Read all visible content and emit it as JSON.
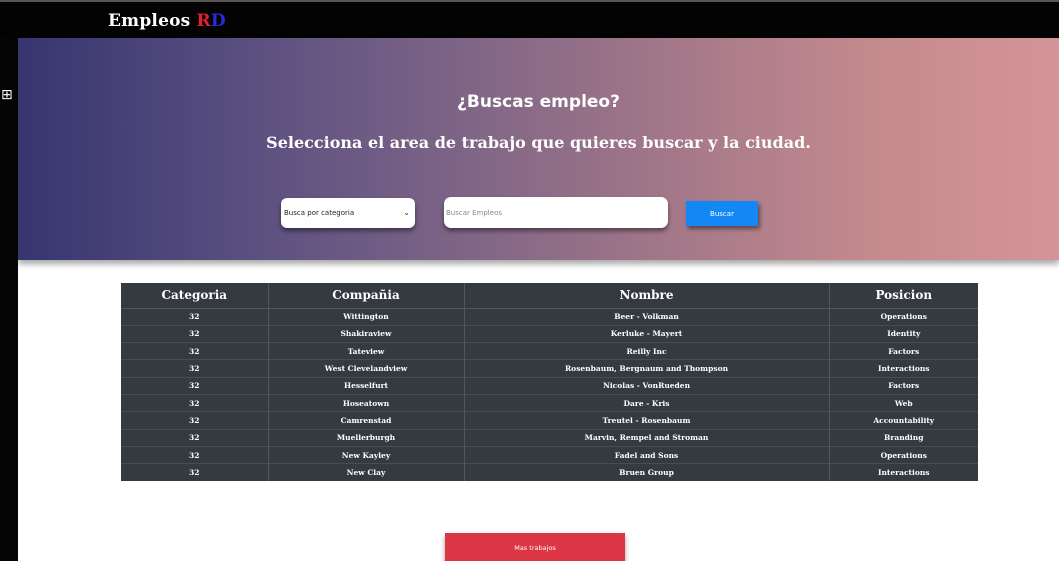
{
  "navbar": {
    "brand_main": "Empleos ",
    "brand_r": "R",
    "brand_d": "D"
  },
  "sidebar": {
    "toggle_icon": "grid-icon",
    "toggle_glyph": "⊞"
  },
  "hero": {
    "question": "¿Buscas empleo?",
    "subtitle": "Selecciona el area de trabajo que quieres buscar y la ciudad.",
    "category_select_value": "Busca por categoria",
    "search_placeholder": "Buscar Empleos",
    "search_button": "Buscar"
  },
  "table": {
    "headers": [
      "Categoria",
      "Compañia",
      "Nombre",
      "Posicion"
    ],
    "rows": [
      [
        "32",
        "Wittington",
        "Beer - Volkman",
        "Operations"
      ],
      [
        "32",
        "Shakiraview",
        "Kerluke - Mayert",
        "Identity"
      ],
      [
        "32",
        "Tateview",
        "Reilly Inc",
        "Factors"
      ],
      [
        "32",
        "West Clevelandview",
        "Rosenbaum, Bergnaum and Thompson",
        "Interactions"
      ],
      [
        "32",
        "Hesselfurt",
        "Nicolas - VonRueden",
        "Factors"
      ],
      [
        "32",
        "Hoseatown",
        "Dare - Kris",
        "Web"
      ],
      [
        "32",
        "Camrenstad",
        "Treutel - Rosenbaum",
        "Accountability"
      ],
      [
        "32",
        "Muellerburgh",
        "Marvin, Rempel and Stroman",
        "Branding"
      ],
      [
        "32",
        "New Kayley",
        "Fadel and Sons",
        "Operations"
      ],
      [
        "32",
        "New Clay",
        "Bruen Group",
        "Interactions"
      ]
    ]
  },
  "more_button": "Mas trabajos",
  "colors": {
    "navbar": "#030303",
    "table_bg": "#343a40",
    "buscar": "#1388f5",
    "mas": "#dc3545",
    "brand_r": "#e2202c",
    "brand_d": "#2b2bd8"
  }
}
